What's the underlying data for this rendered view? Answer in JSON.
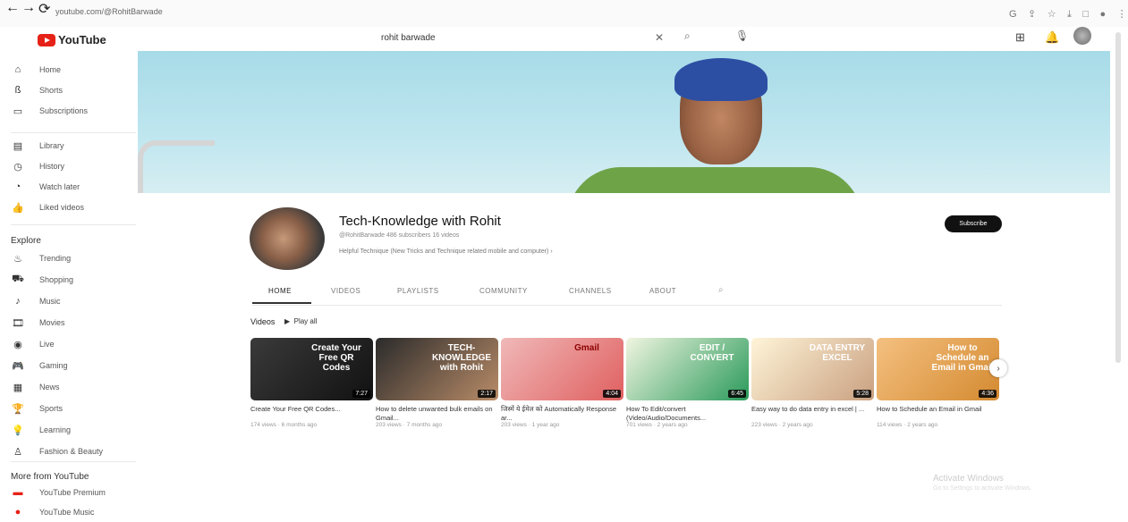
{
  "browser": {
    "url": "youtube.com/@RohitBarwade"
  },
  "header": {
    "logo": "YouTube",
    "search_value": "rohit barwade"
  },
  "sidebar": {
    "main": [
      {
        "label": "Home",
        "icon": "home-icon"
      },
      {
        "label": "Shorts",
        "icon": "shorts-icon"
      },
      {
        "label": "Subscriptions",
        "icon": "subscriptions-icon"
      }
    ],
    "library": [
      {
        "label": "Library",
        "icon": "library-icon"
      },
      {
        "label": "History",
        "icon": "history-icon"
      },
      {
        "label": "Watch later",
        "icon": "watch-later-icon"
      },
      {
        "label": "Liked videos",
        "icon": "liked-icon"
      }
    ],
    "explore_heading": "Explore",
    "explore": [
      {
        "label": "Trending",
        "icon": "trending-icon"
      },
      {
        "label": "Shopping",
        "icon": "shopping-icon"
      },
      {
        "label": "Music",
        "icon": "music-icon"
      },
      {
        "label": "Movies",
        "icon": "movies-icon"
      },
      {
        "label": "Live",
        "icon": "live-icon"
      },
      {
        "label": "Gaming",
        "icon": "gaming-icon"
      },
      {
        "label": "News",
        "icon": "news-icon"
      },
      {
        "label": "Sports",
        "icon": "sports-icon"
      },
      {
        "label": "Learning",
        "icon": "learning-icon"
      },
      {
        "label": "Fashion & Beauty",
        "icon": "fashion-icon"
      }
    ],
    "more_heading": "More from YouTube",
    "more": [
      {
        "label": "YouTube Premium",
        "icon": "premium-icon"
      },
      {
        "label": "YouTube Music",
        "icon": "yt-music-icon"
      }
    ]
  },
  "channel": {
    "name": "Tech-Knowledge with Rohit",
    "meta": "@RohitBarwade  486 subscribers  16 videos",
    "description": "Helpful Technique (New Tricks and Technique related mobile and computer)",
    "subscribe": "Subscribe"
  },
  "tabs": [
    "HOME",
    "VIDEOS",
    "PLAYLISTS",
    "COMMUNITY",
    "CHANNELS",
    "ABOUT"
  ],
  "section": {
    "title": "Videos",
    "play_all": "Play all"
  },
  "videos": [
    {
      "title": "Create Your Free QR Codes...",
      "meta": "174 views · 6 months ago",
      "duration": "7:27",
      "thumb_text": "Create Your Free QR Codes",
      "colors": [
        "#3a3a3a",
        "#111111"
      ]
    },
    {
      "title": "How to delete unwanted bulk emails on Gmail...",
      "meta": "203 views · 7 months ago",
      "duration": "2:17",
      "thumb_text": "TECH-KNOWLEDGE with Rohit",
      "colors": [
        "#2b2b2b",
        "#b98c68"
      ]
    },
    {
      "title": "जिस्में ये ईमेल को Automatically Response ar...",
      "meta": "203 views · 1 year ago",
      "duration": "4:04",
      "thumb_text": "Gmail",
      "colors": [
        "#f0b8b8",
        "#e06060"
      ]
    },
    {
      "title": "How To Edit/convert (Video/Audio/Documents...",
      "meta": "701 views · 2 years ago",
      "duration": "6:45",
      "thumb_text": "EDIT / CONVERT",
      "colors": [
        "#f0f5e0",
        "#2a9a5a"
      ]
    },
    {
      "title": "Easy way to do data entry in excel | ...",
      "meta": "223 views · 2 years ago",
      "duration": "5:28",
      "thumb_text": "DATA ENTRY EXCEL",
      "colors": [
        "#fff4d8",
        "#c9a080"
      ]
    },
    {
      "title": "How to Schedule an Email in Gmail",
      "meta": "114 views · 2 years ago",
      "duration": "4:36",
      "thumb_text": "How to Schedule an Email in Gmail",
      "colors": [
        "#f4c080",
        "#d48a30"
      ]
    }
  ],
  "watermark": {
    "line1": "Activate Windows",
    "line2": "Go to Settings to activate Windows."
  }
}
